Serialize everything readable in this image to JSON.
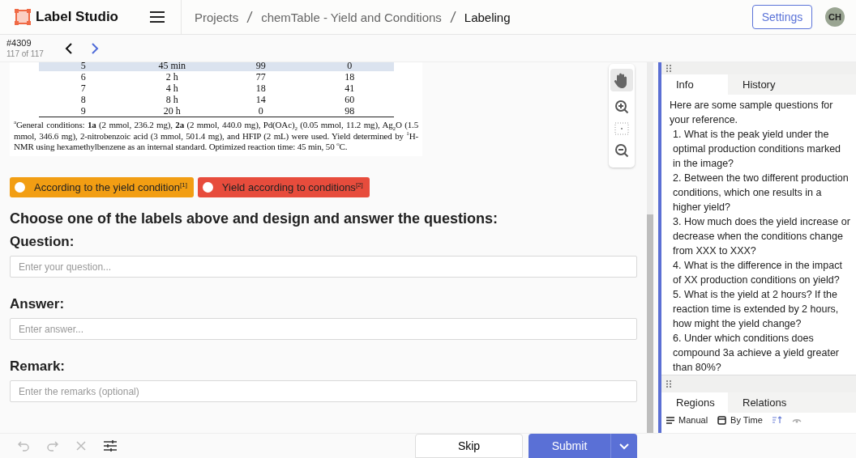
{
  "app": {
    "name": "Label Studio"
  },
  "breadcrumbs": [
    {
      "label": "Projects",
      "current": false
    },
    {
      "label": "chemTable - Yield and Conditions",
      "current": false
    },
    {
      "label": "Labeling",
      "current": true
    }
  ],
  "header_actions": {
    "settings": "Settings",
    "avatar": "CH"
  },
  "task": {
    "id": "#4309",
    "position": "117 of 117"
  },
  "document": {
    "rows": [
      {
        "column_1": "5",
        "column_2": "45 min",
        "column_3": "99",
        "column_4": "0",
        "selected": true
      },
      {
        "column_1": "6",
        "column_2": "2 h",
        "column_3": "77",
        "column_4": "18",
        "selected": false
      },
      {
        "column_1": "7",
        "column_2": "4 h",
        "column_3": "18",
        "column_4": "41",
        "selected": false
      },
      {
        "column_1": "8",
        "column_2": "8 h",
        "column_3": "14",
        "column_4": "60",
        "selected": false
      },
      {
        "column_1": "9",
        "column_2": "20 h",
        "column_3": "0",
        "column_4": "98",
        "selected": false
      }
    ],
    "footnote": "$^{a}$General conditions: **1a** (2 mmol, 236.2 mg), **2a** (2 mmol, 440.0 mg), Pd(OAc)$_{2}$ (0.05 mmol, 11.2 mg), Ag$_{2}$O (1.5 mmol, 346.6 mg), 2-nitrobenzoic acid (3 mmol, 501.4 mg), and HFIP (2 mL) were used. Yield determined by $^{1}$H-NMR using hexamethylbenzene as an internal standard. Optimized reaction time: 45 min, 50 $^{o}$C."
  },
  "labels": [
    {
      "text": "According to the yield condition",
      "hotkey": "[1]",
      "color": "#f29e13",
      "selected": false
    },
    {
      "text": "Yield according to conditions",
      "hotkey": "[2]",
      "color": "#e74c3c",
      "selected": false
    }
  ],
  "instruction": "Choose one of the labels above and design and answer the questions:",
  "fields": [
    {
      "label": "Question:",
      "placeholder": "Enter your question..."
    },
    {
      "label": "Answer:",
      "placeholder": "Enter answer..."
    },
    {
      "label": "Remark:",
      "placeholder": "Enter the remarks (optional)"
    }
  ],
  "bottom_bar": {
    "skip": "Skip",
    "submit": "Submit"
  },
  "info_panel": {
    "tabs": [
      {
        "label": "Info",
        "selected": true
      },
      {
        "label": "History",
        "selected": false
      }
    ],
    "intro": "Here are some sample questions for your reference.",
    "questions": [
      "1. What is the peak yield under the optimal production conditions marked in the image?",
      "2. Between the two different production conditions, which one results in a higher yield?",
      "3. How much does the yield increase or decrease when the conditions change from XXX to XXX?",
      "4. What is the difference in the impact of XX production conditions on yield?",
      "5. What is the yield at 2 hours? If the reaction time is extended by 2 hours, how might the yield change?",
      "6. Under which conditions does compound 3a achieve a yield greater than 80%?"
    ]
  },
  "regions_panel": {
    "tabs": [
      {
        "label": "Regions",
        "selected": true
      },
      {
        "label": "Relations",
        "selected": false
      }
    ],
    "order": "Manual",
    "sort": "By Time"
  }
}
